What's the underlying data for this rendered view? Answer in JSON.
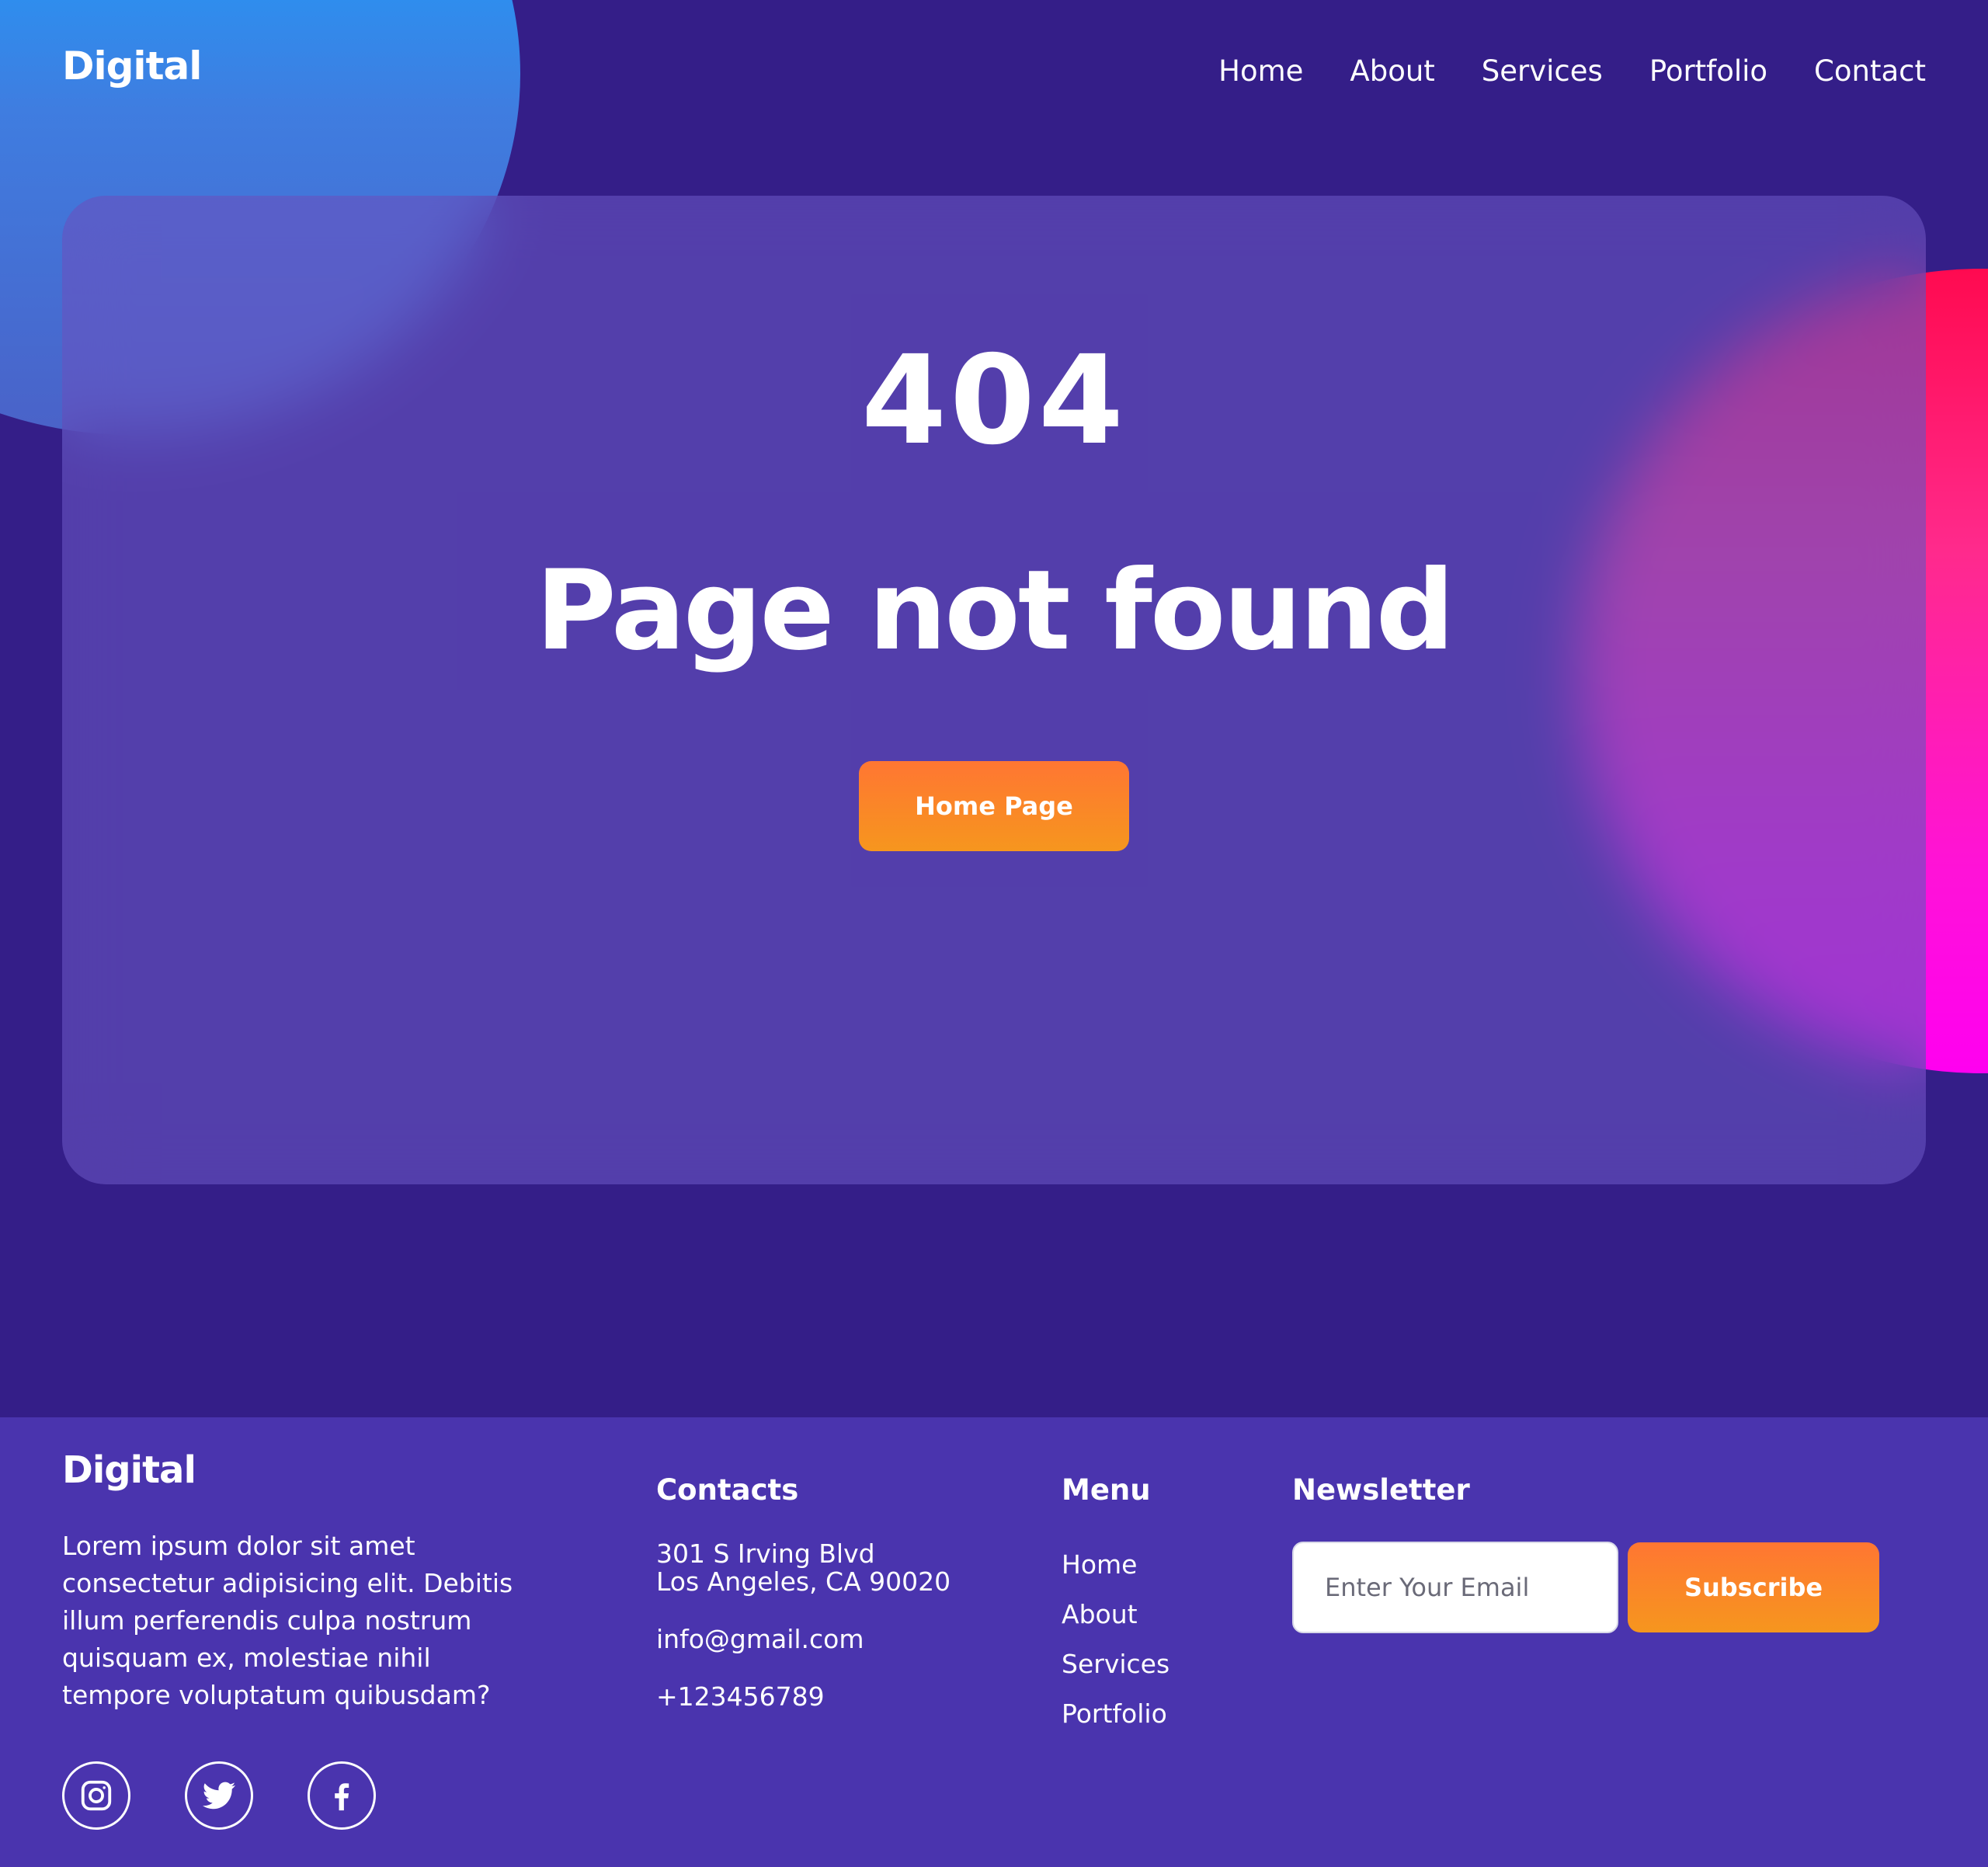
{
  "header": {
    "logo": "Digital",
    "nav": [
      "Home",
      "About",
      "Services",
      "Portfolio",
      "Contact"
    ]
  },
  "hero": {
    "code": "404",
    "title": "Page not found",
    "button_label": "Home Page"
  },
  "footer": {
    "logo": "Digital",
    "about": "Lorem ipsum dolor sit amet consectetur adipisicing elit. Debitis illum perferendis culpa nostrum quisquam ex, molestiae nihil tempore voluptatum quibusdam?",
    "socials": [
      "instagram-icon",
      "twitter-icon",
      "facebook-icon"
    ],
    "contacts": {
      "heading": "Contacts",
      "address_line1": "301 S Irving Blvd",
      "address_line2": "Los Angeles, CA 90020",
      "email": "info@gmail.com",
      "phone": "+123456789"
    },
    "menu": {
      "heading": "Menu",
      "items": [
        "Home",
        "About",
        "Services",
        "Portfolio"
      ]
    },
    "newsletter": {
      "heading": "Newsletter",
      "placeholder": "Enter Your Email",
      "button_label": "Subscribe"
    }
  },
  "colors": {
    "background": "#341e88",
    "footer": "#4a34ae",
    "accent_orange": "#ff7632",
    "blob_blue": "#1aa2ff",
    "blob_pink": "#ff2a8c"
  }
}
